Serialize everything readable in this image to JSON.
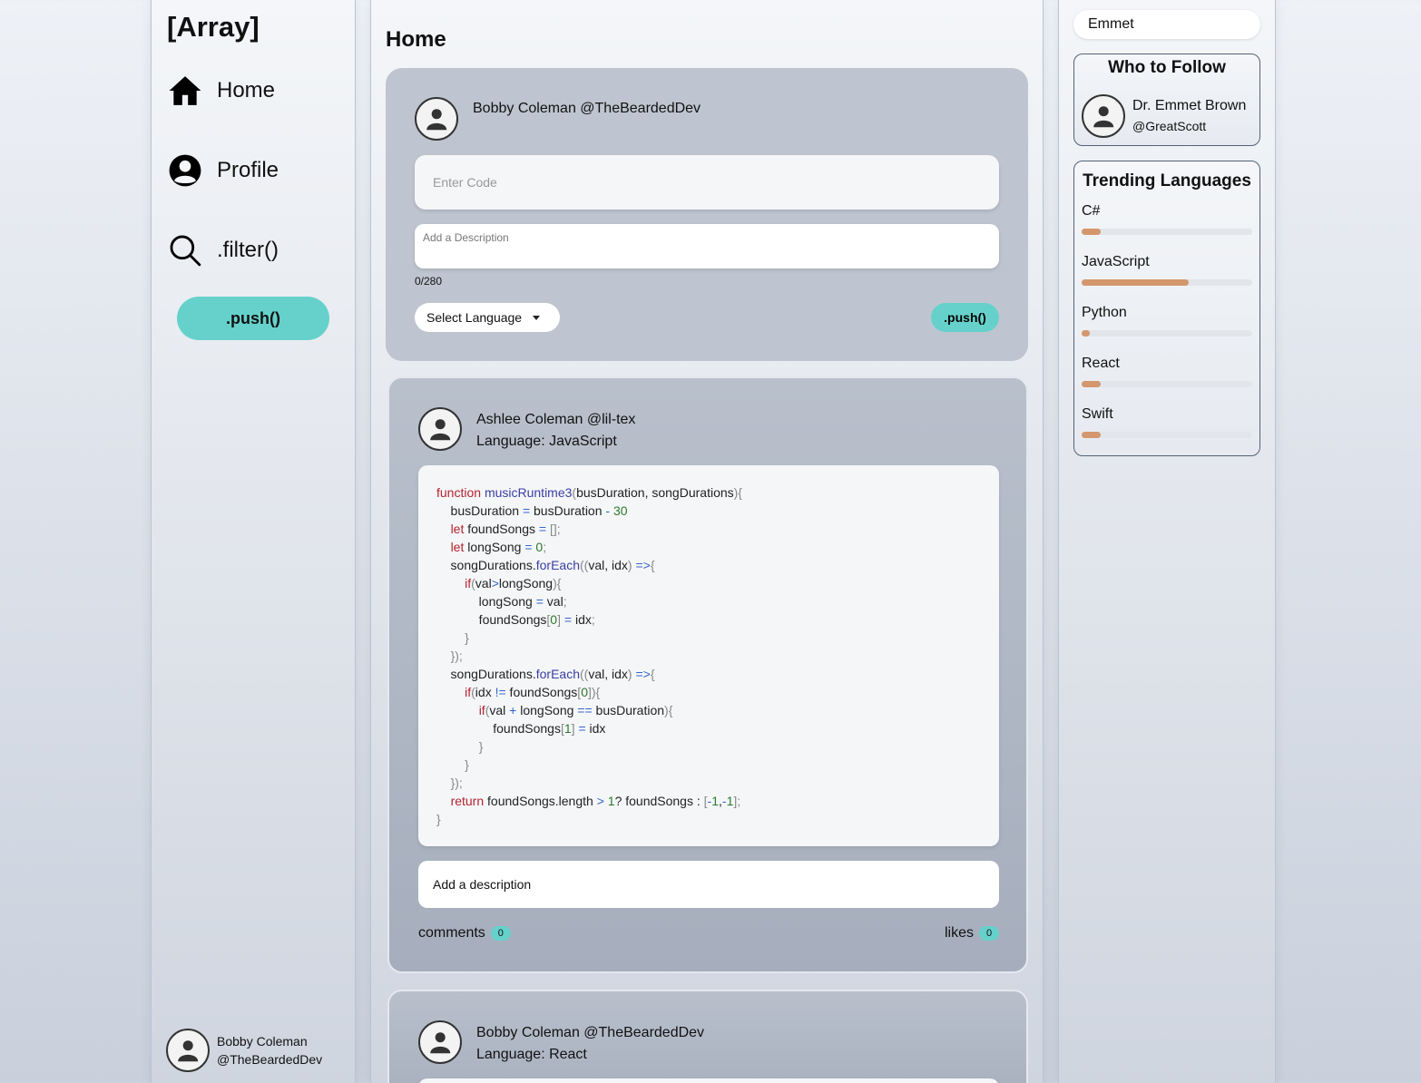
{
  "sidebar": {
    "logo": "[Array]",
    "nav": [
      {
        "label": "Home",
        "icon": "home-icon"
      },
      {
        "label": "Profile",
        "icon": "user-circle-icon"
      },
      {
        "label": ".filter()",
        "icon": "search-icon"
      }
    ],
    "push_label": ".push()",
    "user": {
      "name": "Bobby Coleman",
      "handle": "@TheBeardedDev"
    }
  },
  "feed": {
    "title": "Home",
    "compose": {
      "user": "Bobby Coleman @TheBeardedDev",
      "code_placeholder": "Enter Code",
      "desc_placeholder": "Add a Description",
      "counter": "0/280",
      "language_label": "Select Language",
      "push_label": ".push()"
    },
    "posts": [
      {
        "user": "Ashlee Coleman @lil-tex",
        "language": "Language: JavaScript",
        "description": "Add a description",
        "comments_label": "comments",
        "comments": "0",
        "likes_label": "likes",
        "likes": "0"
      },
      {
        "user": "Bobby Coleman @TheBeardedDev",
        "language": "Language: React"
      }
    ]
  },
  "aside": {
    "search_value": "Emmet",
    "who_to_follow": {
      "title": "Who to Follow",
      "name": "Dr. Emmet Brown",
      "handle": "@GreatScott"
    },
    "trending": {
      "title": "Trending Languages",
      "languages": [
        {
          "name": "C#",
          "share": 0.11
        },
        {
          "name": "JavaScript",
          "share": 0.63
        },
        {
          "name": "Python",
          "share": 0.05
        },
        {
          "name": "React",
          "share": 0.11
        },
        {
          "name": "Swift",
          "share": 0.11
        }
      ]
    }
  },
  "colors": {
    "accent": "#66d1cb",
    "bar_fill": "#d4976d"
  }
}
